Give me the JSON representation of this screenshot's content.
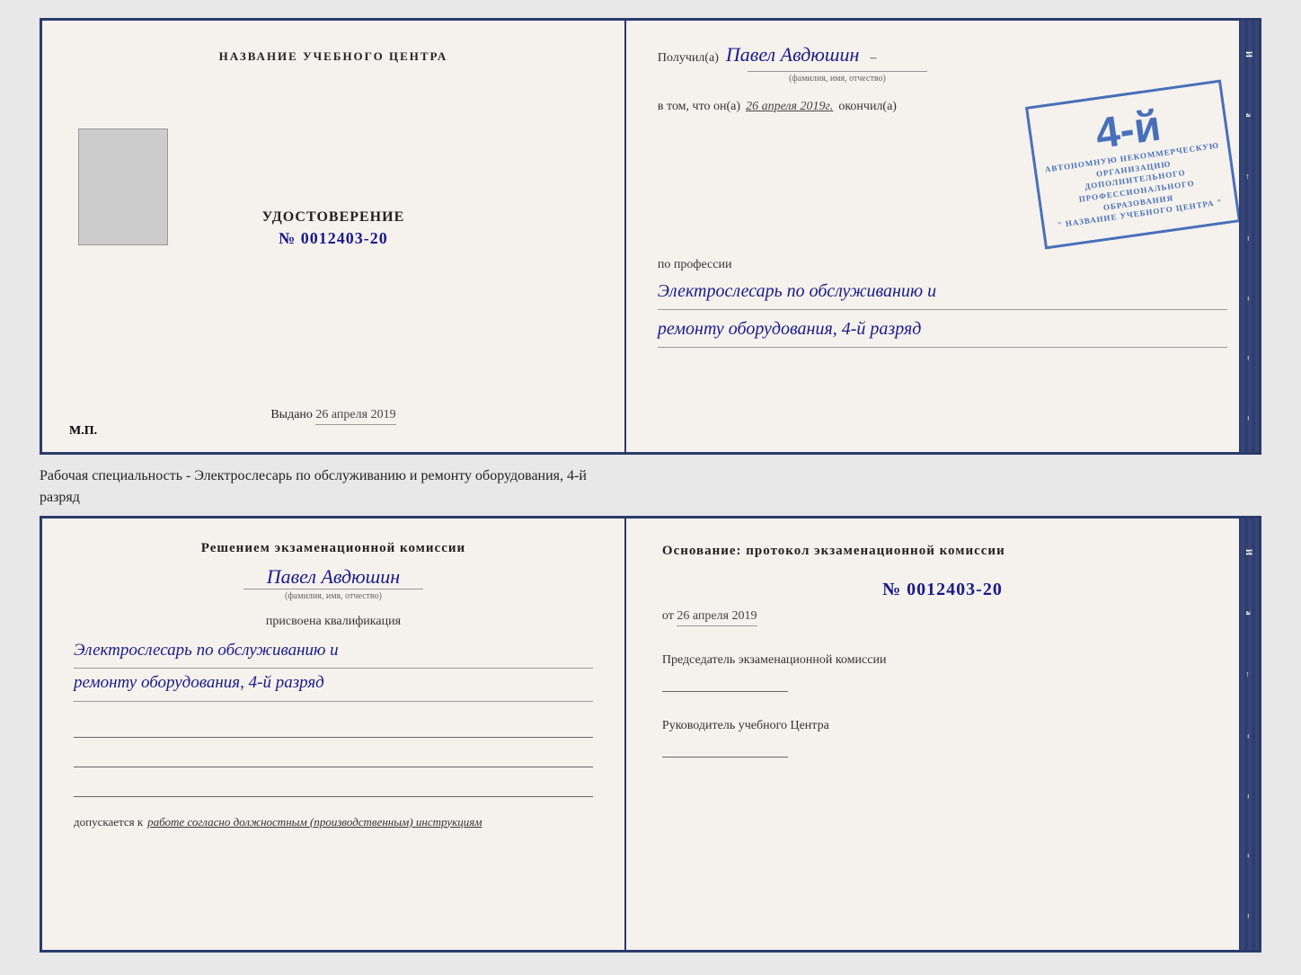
{
  "background": "#e8e8e8",
  "top_document": {
    "left": {
      "title": "НАЗВАНИЕ УЧЕБНОГО ЦЕНТРА",
      "udostoverenie_label": "УДОСТОВЕРЕНИЕ",
      "number": "№ 0012403-20",
      "vydano_label": "Выдано",
      "vydano_date": "26 апреля 2019",
      "mp": "М.П."
    },
    "right": {
      "poluchil_label": "Получил(a)",
      "name": "Павел Авдюшин",
      "fio_label": "(фамилия, имя, отчество)",
      "vtom_label": "в том, что он(a)",
      "date_italic": "26 апреля 2019г.",
      "okonchil": "окончил(а)",
      "stamp_number": "4-й",
      "stamp_line1": "АВТОНОМНУЮ НЕКОММЕРЧЕСКУЮ ОРГАНИЗАЦИЮ",
      "stamp_line2": "ДОПОЛНИТЕЛЬНОГО ПРОФЕССИОНАЛЬНОГО ОБРАЗОВАНИЯ",
      "stamp_line3": "\" НАЗВАНИЕ УЧЕБНОГО ЦЕНТРА \"",
      "po_professii": "по профессии",
      "profession_line1": "Электрослесарь по обслуживанию и",
      "profession_line2": "ремонту оборудования, 4-й разряд"
    }
  },
  "between_text": {
    "line1": "Рабочая специальность - Электрослесарь по обслуживанию и ремонту оборудования, 4-й",
    "line2": "разряд"
  },
  "bottom_document": {
    "left": {
      "resheniem_label": "Решением экзаменационной комиссии",
      "name": "Павел Авдюшин",
      "fio_label": "(фамилия, имя, отчество)",
      "prisvoena": "присвоена квалификация",
      "profession_line1": "Электрослесарь по обслуживанию и",
      "profession_line2": "ремонту оборудования, 4-й разряд",
      "dopuskaetsya_label": "допускается к",
      "dopuskaetsya_italic": "работе согласно должностным (производственным) инструкциям"
    },
    "right": {
      "osnovanie_label": "Основание: протокол экзаменационной комиссии",
      "number": "№  0012403-20",
      "ot_label": "от",
      "ot_date": "26 апреля 2019",
      "predsedatel_label": "Председатель экзаменационной комиссии",
      "rukovoditel_label": "Руководитель учебного Центра"
    }
  },
  "spine_chars": [
    "И",
    "а",
    "←",
    "–",
    "–",
    "–",
    "–",
    "–"
  ]
}
